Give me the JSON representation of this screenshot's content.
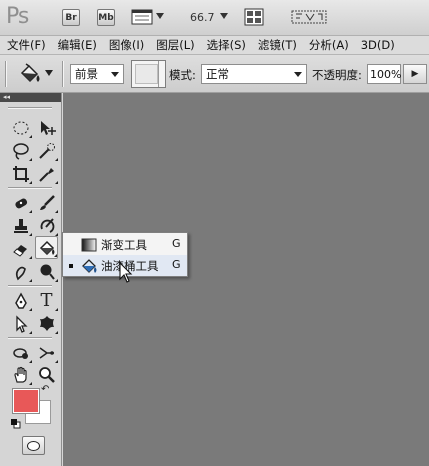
{
  "app": {
    "logo": "Ps",
    "bridge_label": "Br",
    "minibridge_label": "Mb",
    "zoom": "66.7"
  },
  "menu": [
    {
      "label": "文件(F)"
    },
    {
      "label": "编辑(E)"
    },
    {
      "label": "图像(I)"
    },
    {
      "label": "图层(L)"
    },
    {
      "label": "选择(S)"
    },
    {
      "label": "滤镜(T)"
    },
    {
      "label": "分析(A)"
    },
    {
      "label": "3D(D)"
    }
  ],
  "options": {
    "fill_source": "前景",
    "mode_label": "模式:",
    "mode_value": "正常",
    "opacity_label": "不透明度:",
    "opacity_value": "100%"
  },
  "toolbox": {
    "collapse_glyph": "◂◂",
    "text_tool": "T"
  },
  "colors": {
    "foreground": "#e85858",
    "background": "#ffffff",
    "canvas": "#7a7a7a"
  },
  "flyout": {
    "items": [
      {
        "label": "渐变工具",
        "shortcut": "G",
        "icon": "gradient-icon",
        "selected": false
      },
      {
        "label": "油漆桶工具",
        "shortcut": "G",
        "icon": "paint-bucket-icon",
        "selected": true
      }
    ]
  }
}
